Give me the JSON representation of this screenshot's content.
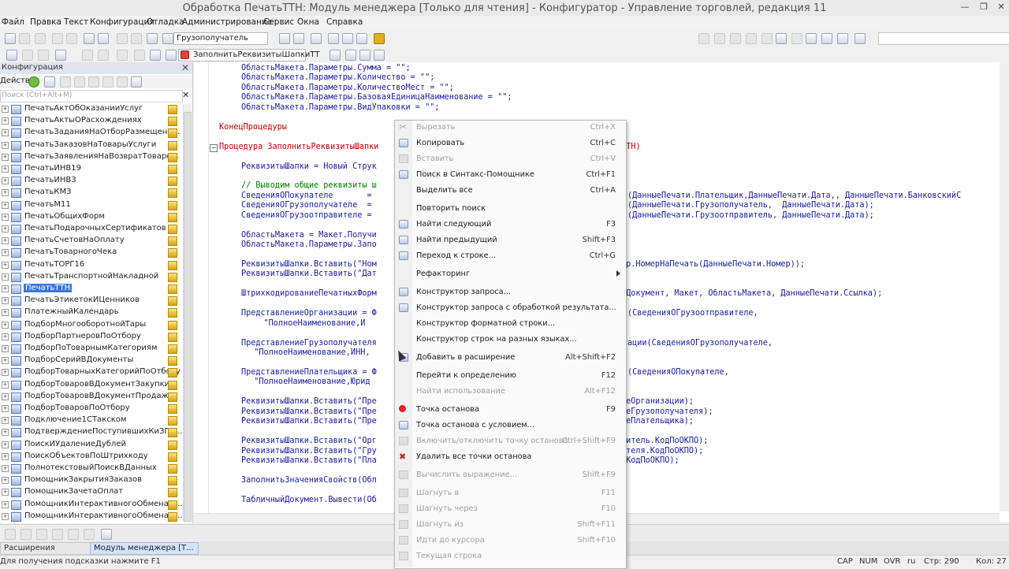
{
  "window": {
    "title": "Обработка ПечатьТТН: Модуль менеджера [Только для чтения] - Конфигуратор - Управление торговлей, редакция 11"
  },
  "menu": [
    "Файл",
    "Правка",
    "Текст",
    "Конфигурация",
    "Отладка",
    "Администрирование",
    "Сервис",
    "Окна",
    "Справка"
  ],
  "toolbar": {
    "search_value": "Грузополучатель",
    "procedure_value": "ЗаполнитьРеквизитыШапкиТТ"
  },
  "left_panel": {
    "title": "Конфигурация",
    "actions_label": "Действия",
    "search_placeholder": "Поиск (Ctrl+Alt+M)",
    "items": [
      "ПечатьАктОбОказанииУслуг",
      "ПечатьАктыОРасхождениях",
      "ПечатьЗаданияНаОтборРазмещени...",
      "ПечатьЗаказовНаТоварыУслуги",
      "ПечатьЗаявленияНаВозвратТоваро...",
      "ПечатьИНВ19",
      "ПечатьИНВ3",
      "ПечатьКМ3",
      "ПечатьМ11",
      "ПечатьОбщихФорм",
      "ПечатьПодарочныхСертификатов",
      "ПечатьСчетовНаОплату",
      "ПечатьТоварногоЧека",
      "ПечатьТОРГ16",
      "ПечатьТранспортнойНакладной",
      "ПечатьТТН",
      "ПечатьЭтикетокИЦенников",
      "ПлатежныйКалендарь",
      "ПодборМногооборотнойТары",
      "ПодборПартнеровПоОтбору",
      "ПодборПоТоварнымКатегориям",
      "ПодборСерийВДокументы",
      "ПодборТоварныхКатегорийПоОтбору",
      "ПодборТоваровВДокументЗакупки",
      "ПодборТоваровВДокументПродажи",
      "ПодборТоваровПоОтбору",
      "Подключение1СТакском",
      "ПодтверждениеПоступившихКиЗГИ...",
      "ПоискИУдалениеДублей",
      "ПоискОбъектовПоШтрихкоду",
      "ПолнотекстовыйПоискВДанных",
      "ПомощникЗакрытияЗаказов",
      "ПомощникЗачетаОплат",
      "ПомощникИнтерактивногоОбменаД...",
      "ПомощникИнтерактивногоОбменаД..."
    ],
    "selected_index": 15
  },
  "code": [
    {
      "t": "ОбластьМакета.Параметры.Сумма = \"\";",
      "c": "n",
      "i": 1
    },
    {
      "t": "ОбластьМакета.Параметры.Количество = \"\";",
      "c": "n",
      "i": 1
    },
    {
      "t": "ОбластьМакета.Параметры.КоличествоМест = \"\";",
      "c": "n",
      "i": 1
    },
    {
      "t": "ОбластьМакета.Параметры.БазоваяЕдиницаНаименование = \"\";",
      "c": "n",
      "i": 1
    },
    {
      "t": "ОбластьМакета.Параметры.ВидУпаковки = \"\";",
      "c": "n",
      "i": 1
    },
    {
      "t": "",
      "c": "n",
      "i": 0
    },
    {
      "t": "КонецПроцедуры",
      "c": "k",
      "i": 0
    },
    {
      "t": "",
      "c": "n",
      "i": 0
    },
    {
      "t": "Процедура ЗаполнитьРеквизитыШапки",
      "c": "k",
      "i": 0
    },
    {
      "t": "",
      "c": "n",
      "i": 0
    },
    {
      "t": "РеквизитыШапки = Новый Струк",
      "c": "n",
      "i": 1
    },
    {
      "t": "",
      "c": "n",
      "i": 0
    },
    {
      "t": "// Выводим общие реквизиты ш",
      "c": "g",
      "i": 1
    },
    {
      "t": "СведенияОПокупателе       =",
      "c": "n",
      "i": 1
    },
    {
      "t": "СведенияОГрузополучателе  =",
      "c": "n",
      "i": 1
    },
    {
      "t": "СведенияОГрузоотправителе =",
      "c": "n",
      "i": 1
    },
    {
      "t": "",
      "c": "n",
      "i": 0
    },
    {
      "t": "ОбластьМакета = Макет.Получи",
      "c": "n",
      "i": 1
    },
    {
      "t": "ОбластьМакета.Параметры.Запо",
      "c": "n",
      "i": 1
    },
    {
      "t": "",
      "c": "n",
      "i": 0
    },
    {
      "t": "РеквизитыШапки.Вставить(\"Ном",
      "c": "n",
      "i": 1
    },
    {
      "t": "РеквизитыШапки.Вставить(\"Дат",
      "c": "n",
      "i": 1
    },
    {
      "t": "",
      "c": "n",
      "i": 0
    },
    {
      "t": "ШтрихкодированиеПечатныхФорм",
      "c": "n",
      "i": 1
    },
    {
      "t": "",
      "c": "n",
      "i": 0
    },
    {
      "t": "ПредставлениеОрганизации = Ф",
      "c": "n",
      "i": 1
    },
    {
      "t": "    \"ПолноеНаименование,И",
      "c": "n",
      "i": 2
    },
    {
      "t": "",
      "c": "n",
      "i": 0
    },
    {
      "t": "ПредставлениеГрузополучателя",
      "c": "n",
      "i": 1
    },
    {
      "t": "  \"ПолноеНаименование,ИНН,",
      "c": "n",
      "i": 2
    },
    {
      "t": "",
      "c": "n",
      "i": 0
    },
    {
      "t": "ПредставлениеПлательщика = Ф",
      "c": "n",
      "i": 1
    },
    {
      "t": "  \"ПолноеНаименование,Юрид",
      "c": "n",
      "i": 2
    },
    {
      "t": "",
      "c": "n",
      "i": 0
    },
    {
      "t": "РеквизитыШапки.Вставить(\"Пре",
      "c": "n",
      "i": 1
    },
    {
      "t": "РеквизитыШапки.Вставить(\"Пре",
      "c": "n",
      "i": 1
    },
    {
      "t": "РеквизитыШапки.Вставить(\"Пре",
      "c": "n",
      "i": 1
    },
    {
      "t": "",
      "c": "n",
      "i": 0
    },
    {
      "t": "РеквизитыШапки.Вставить(\"Орг",
      "c": "n",
      "i": 1
    },
    {
      "t": "РеквизитыШапки.Вставить(\"Гру",
      "c": "n",
      "i": 1
    },
    {
      "t": "РеквизитыШапки.Вставить(\"Пла",
      "c": "n",
      "i": 1
    },
    {
      "t": "",
      "c": "n",
      "i": 0
    },
    {
      "t": "ЗаполнитьЗначенияСвойств(Обл",
      "c": "n",
      "i": 1
    },
    {
      "t": "",
      "c": "n",
      "i": 0
    },
    {
      "t": "ТабличныйДокумент.Вывести(Об",
      "c": "n",
      "i": 1
    }
  ],
  "code_right": [
    {
      "row": 8,
      "t": "ьТТН)"
    },
    {
      "row": 13,
      "t": "(ДанныеПечати.Плательщик,ДанныеПечати.Дата,, ДанныеПечати.БанковскийС"
    },
    {
      "row": 14,
      "t": "(ДанныеПечати.Грузополучатель,  ДанныеПечати.Дата);"
    },
    {
      "row": 15,
      "t": "(ДанныеПечати.Грузоотправитель, ДанныеПечати.Дата);"
    },
    {
      "row": 20,
      "t": "ер.НомерНаПечать(ДанныеПечати.Номер));"
    },
    {
      "row": 23,
      "t": "йДокумент, Макет, ОбластьМакета, ДанныеПечати.Ссылка);"
    },
    {
      "row": 25,
      "t": "(СведенияОГрузоотправителе,"
    },
    {
      "row": 28,
      "t": "ации(СведенияОГрузополучателе,"
    },
    {
      "row": 31,
      "t": "(СведенияОПокупателе,"
    },
    {
      "row": 34,
      "t": "иеОрганизации);"
    },
    {
      "row": 35,
      "t": "иеГрузополучателя);"
    },
    {
      "row": 36,
      "t": "иеПлательщика);"
    },
    {
      "row": 38,
      "t": "витель.КодПоОКПО);"
    },
    {
      "row": 39,
      "t": "ателя.КодПоОКПО);"
    },
    {
      "row": 40,
      "t": ".КодПоОКПО);"
    }
  ],
  "context_menu": [
    {
      "label": "Вырезать",
      "key": "Ctrl+X",
      "disabled": true,
      "icon": "scissors-icon"
    },
    {
      "label": "Копировать",
      "key": "Ctrl+C",
      "disabled": false,
      "icon": "copy-icon"
    },
    {
      "label": "Вставить",
      "key": "Ctrl+V",
      "disabled": true,
      "icon": "paste-icon"
    },
    {
      "label": "Поиск в Синтакс-Помощнике",
      "key": "Ctrl+F1",
      "disabled": false,
      "icon": "syntax-help-icon"
    },
    {
      "label": "Выделить все",
      "key": "Ctrl+A",
      "disabled": false,
      "icon": ""
    },
    {
      "sep": true
    },
    {
      "label": "Повторить поиск",
      "key": "",
      "disabled": false,
      "icon": ""
    },
    {
      "label": "Найти следующий",
      "key": "F3",
      "disabled": false,
      "icon": "find-next-icon"
    },
    {
      "label": "Найти предыдущий",
      "key": "Shift+F3",
      "disabled": false,
      "icon": "find-prev-icon"
    },
    {
      "label": "Переход к строке...",
      "key": "Ctrl+G",
      "disabled": false,
      "icon": "goto-line-icon"
    },
    {
      "sep": true
    },
    {
      "label": "Рефакторинг",
      "key": "",
      "disabled": false,
      "icon": "",
      "submenu": true
    },
    {
      "sep": true
    },
    {
      "label": "Конструктор запроса...",
      "key": "",
      "disabled": false,
      "icon": "query-builder-icon"
    },
    {
      "label": "Конструктор запроса с обработкой результата...",
      "key": "",
      "disabled": false,
      "icon": "query-result-icon"
    },
    {
      "label": "Конструктор форматной строки...",
      "key": "",
      "disabled": false,
      "icon": ""
    },
    {
      "label": "Конструктор строк на разных языках...",
      "key": "",
      "disabled": false,
      "icon": ""
    },
    {
      "sep": true
    },
    {
      "label": "Добавить в расширение",
      "key": "Alt+Shift+F2",
      "disabled": false,
      "icon": "add-extension-icon"
    },
    {
      "sep": true
    },
    {
      "label": "Перейти к определению",
      "key": "F12",
      "disabled": false,
      "icon": ""
    },
    {
      "label": "Найти использование",
      "key": "Alt+F12",
      "disabled": true,
      "icon": ""
    },
    {
      "sep": true
    },
    {
      "label": "Точка останова",
      "key": "F9",
      "disabled": false,
      "icon": "breakpoint-icon"
    },
    {
      "label": "Точка останова с условием...",
      "key": "",
      "disabled": false,
      "icon": "conditional-breakpoint-icon"
    },
    {
      "label": "Включить/отключить точку останова",
      "key": "Ctrl+Shift+F9",
      "disabled": true,
      "icon": "toggle-breakpoint-icon"
    },
    {
      "label": "Удалить все точки останова",
      "key": "",
      "disabled": false,
      "icon": "delete-breakpoints-icon"
    },
    {
      "sep": true
    },
    {
      "label": "Вычислить выражение...",
      "key": "Shift+F9",
      "disabled": true,
      "icon": "evaluate-icon"
    },
    {
      "sep": true
    },
    {
      "label": "Шагнуть в",
      "key": "F11",
      "disabled": true,
      "icon": "step-into-icon"
    },
    {
      "label": "Шагнуть через",
      "key": "F10",
      "disabled": true,
      "icon": "step-over-icon"
    },
    {
      "label": "Шагнуть из",
      "key": "Shift+F11",
      "disabled": true,
      "icon": "step-out-icon"
    },
    {
      "label": "Идти до курсора",
      "key": "Shift+F10",
      "disabled": true,
      "icon": "run-to-cursor-icon"
    },
    {
      "label": "Текущая строка",
      "key": "",
      "disabled": true,
      "icon": "current-line-icon"
    }
  ],
  "taskbar": {
    "tab1": "Расширения конфигура...",
    "tab2": "Модуль менеджера [Т..."
  },
  "status": {
    "hint": "Для получения подсказки нажмите F1",
    "cap": "CAP",
    "num": "NUM",
    "ovr": "OVR",
    "lang": "ru",
    "line": "Стр: 290",
    "col": "Кол: 27"
  }
}
